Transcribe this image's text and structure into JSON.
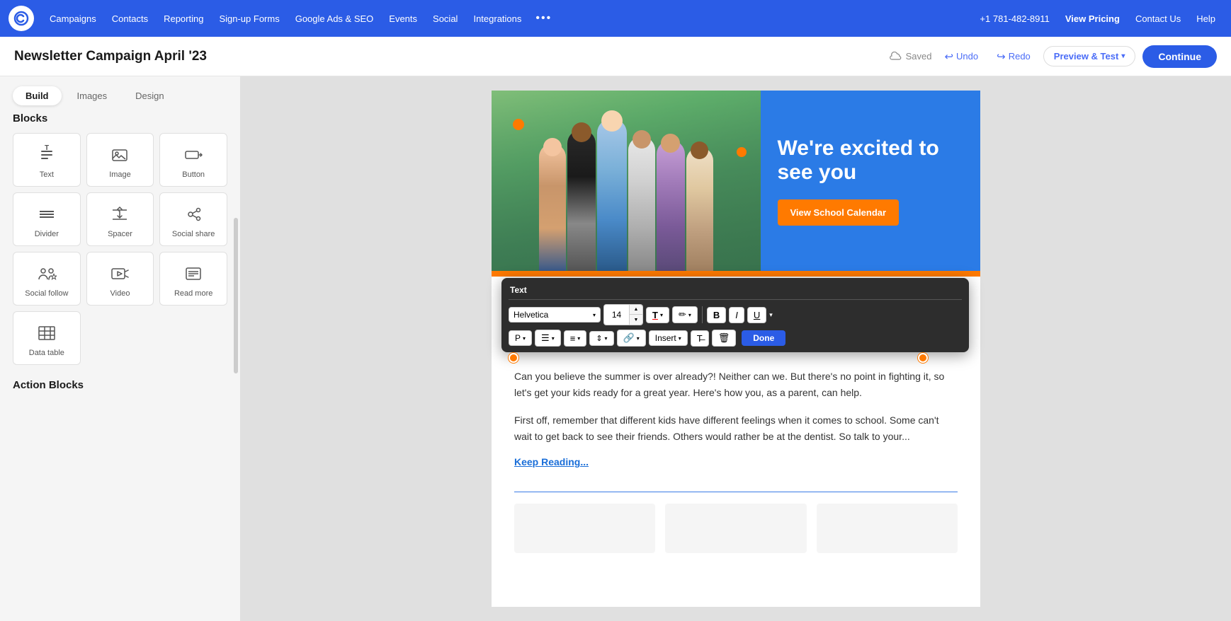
{
  "nav": {
    "items": [
      {
        "label": "Campaigns",
        "id": "campaigns"
      },
      {
        "label": "Contacts",
        "id": "contacts"
      },
      {
        "label": "Reporting",
        "id": "reporting"
      },
      {
        "label": "Sign-up Forms",
        "id": "signup-forms"
      },
      {
        "label": "Google Ads & SEO",
        "id": "google-ads-seo"
      },
      {
        "label": "Events",
        "id": "events"
      },
      {
        "label": "Social",
        "id": "social"
      },
      {
        "label": "Integrations",
        "id": "integrations"
      }
    ],
    "phone": "+1 781-482-8911",
    "view_pricing": "View Pricing",
    "contact_us": "Contact Us",
    "help": "Help"
  },
  "header": {
    "campaign_title": "Newsletter Campaign April '23",
    "saved_label": "Saved",
    "undo_label": "Undo",
    "redo_label": "Redo",
    "preview_test_label": "Preview & Test",
    "continue_label": "Continue"
  },
  "sidebar": {
    "tabs": [
      {
        "label": "Build",
        "active": true
      },
      {
        "label": "Images",
        "active": false
      },
      {
        "label": "Design",
        "active": false
      }
    ],
    "blocks_title": "Blocks",
    "blocks": [
      {
        "label": "Text",
        "icon": "T"
      },
      {
        "label": "Image",
        "icon": "🖼"
      },
      {
        "label": "Button",
        "icon": "☐→"
      },
      {
        "label": "Divider",
        "icon": "☰"
      },
      {
        "label": "Spacer",
        "icon": "⬍"
      },
      {
        "label": "Social share",
        "icon": "👤⇗"
      },
      {
        "label": "Social follow",
        "icon": "⊙"
      },
      {
        "label": "Video",
        "icon": "▶"
      },
      {
        "label": "Read more",
        "icon": "≡"
      },
      {
        "label": "Data table",
        "icon": "⊞"
      }
    ],
    "action_blocks_title": "Action Blocks"
  },
  "email": {
    "hero_title": "We're excited to see you",
    "hero_btn_label": "View School Calendar",
    "text_toolbar_title": "Text",
    "font_family": "Helvetica",
    "font_size": "14",
    "paragraph_tag": "P",
    "toolbar_buttons": [
      "B",
      "I",
      "U"
    ],
    "insert_label": "Insert",
    "done_label": "Done",
    "body_text_1": "Can you believe the summer is over already?! Neither can we. But there's no point in fighting it, so let's get your kids ready for a great year. Here's how you, as a parent, can help.",
    "body_text_2": "First off, remember that different kids have different feelings when it comes to school. Some can't wait to get back to see their friends. Others would rather be at the dentist. So talk to your...",
    "keep_reading_label": "Keep Reading..."
  }
}
